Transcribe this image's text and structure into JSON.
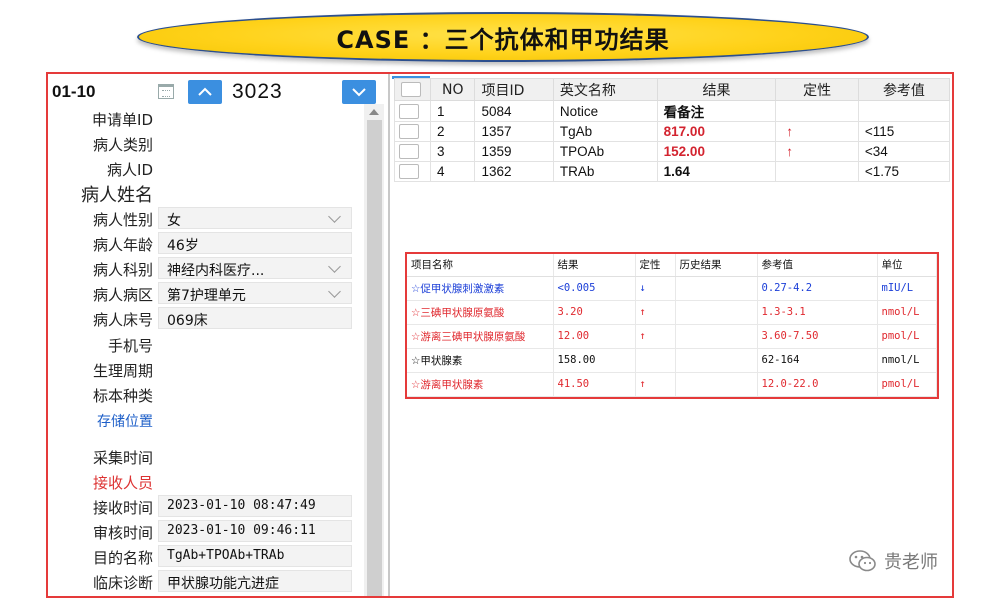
{
  "banner": {
    "title": "CASE ：三个抗体和甲功结果"
  },
  "header": {
    "date": "01-10",
    "year": "3023",
    "up_icon": "chevron-up-icon",
    "down_icon": "chevron-down-icon",
    "calendar_icon": "calendar-icon",
    "accent": "#3b8fe0"
  },
  "patient": {
    "fields": [
      {
        "label": "申请单ID",
        "value": ""
      },
      {
        "label": "病人类别",
        "value": ""
      },
      {
        "label": "病人ID",
        "value": ""
      },
      {
        "label": "病人姓名",
        "value": ""
      },
      {
        "label": "病人性别",
        "value": "女"
      },
      {
        "label": "病人年龄",
        "value": "46岁"
      },
      {
        "label": "病人科别",
        "value": "神经内科医疗..."
      },
      {
        "label": "病人病区",
        "value": "第7护理单元"
      },
      {
        "label": "病人床号",
        "value": "069床"
      },
      {
        "label": "手机号",
        "value": ""
      },
      {
        "label": "生理周期",
        "value": ""
      },
      {
        "label": "标本种类",
        "value": ""
      },
      {
        "label": "存储位置",
        "value": ""
      },
      {
        "label": "采集时间",
        "value": ""
      },
      {
        "label": "接收人员",
        "value": ""
      },
      {
        "label": "接收时间",
        "value": "2023-01-10 08:47:49"
      },
      {
        "label": "审核时间",
        "value": "2023-01-10 09:46:11"
      },
      {
        "label": "目的名称",
        "value": "TgAb+TPOAb+TRAb"
      },
      {
        "label": "临床诊断",
        "value": "甲状腺功能亢进症"
      }
    ]
  },
  "results": {
    "headers": [
      "NO",
      "项目ID",
      "英文名称",
      "结果",
      "定性",
      "参考值"
    ],
    "rows": [
      {
        "no": "1",
        "id": "5084",
        "name": "Notice",
        "result": "看备注",
        "flag": "",
        "ref": ""
      },
      {
        "no": "2",
        "id": "1357",
        "name": "TgAb",
        "result": "817.00",
        "flag": "↑",
        "ref": "<115"
      },
      {
        "no": "3",
        "id": "1359",
        "name": "TPOAb",
        "result": "152.00",
        "flag": "↑",
        "ref": "<34"
      },
      {
        "no": "4",
        "id": "1362",
        "name": "TRAb",
        "result": "1.64",
        "flag": "",
        "ref": "<1.75"
      }
    ]
  },
  "lab": {
    "headers": [
      "项目名称",
      "结果",
      "定性",
      "历史结果",
      "参考值",
      "单位"
    ],
    "rows": [
      {
        "name": "☆促甲状腺刺激激素",
        "result": "<0.005",
        "flag": "↓",
        "history": "",
        "ref": "0.27-4.2",
        "unit": "mIU/L",
        "color": "blue"
      },
      {
        "name": "☆三碘甲状腺原氨酸",
        "result": "3.20",
        "flag": "↑",
        "history": "",
        "ref": "1.3-3.1",
        "unit": "nmol/L",
        "color": "red"
      },
      {
        "name": "☆游离三碘甲状腺原氨酸",
        "result": "12.00",
        "flag": "↑",
        "history": "",
        "ref": "3.60-7.50",
        "unit": "pmol/L",
        "color": "red"
      },
      {
        "name": "☆甲状腺素",
        "result": "158.00",
        "flag": "",
        "history": "",
        "ref": "62-164",
        "unit": "nmol/L",
        "color": "black"
      },
      {
        "name": "☆游离甲状腺素",
        "result": "41.50",
        "flag": "↑",
        "history": "",
        "ref": "12.0-22.0",
        "unit": "pmol/L",
        "color": "red"
      }
    ]
  },
  "watermark": {
    "text": "贵老师",
    "icon": "wechat-icon"
  }
}
